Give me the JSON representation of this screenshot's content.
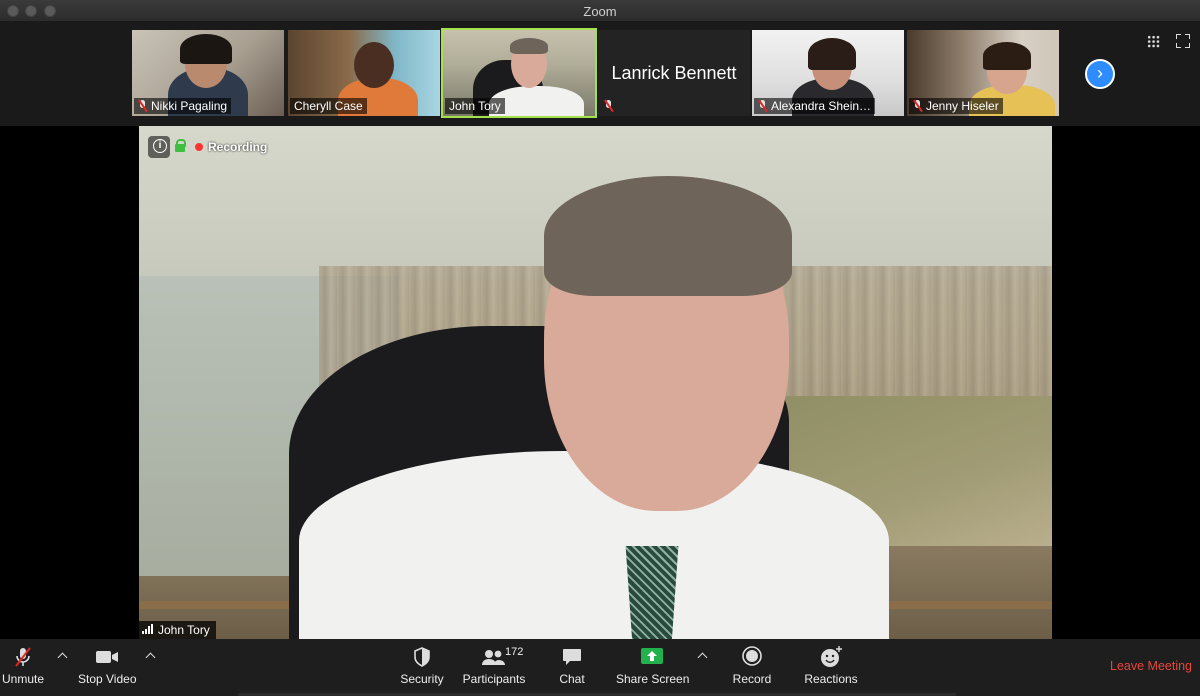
{
  "window": {
    "title": "Zoom"
  },
  "gallery": {
    "tiles": [
      {
        "name": "Nikki Pagaling",
        "muted": true
      },
      {
        "name": "Cheryll Case",
        "muted": false
      },
      {
        "name": "John Tory",
        "muted": false,
        "active_speaker": true
      },
      {
        "name": "Lanrick Bennett",
        "muted": true,
        "video_off": true
      },
      {
        "name": "Alexandra Shein…",
        "muted": true
      },
      {
        "name": "Jenny Hiseler",
        "muted": true
      }
    ],
    "next_icon": "chevron-right-icon",
    "view_icon": "grid-view-icon",
    "fullscreen_icon": "fullscreen-icon"
  },
  "main_video": {
    "recording_label": "Recording",
    "speaker_name": "John Tory",
    "accent": "#2d8cff",
    "active_outline": "#a5e14e"
  },
  "toolbar": {
    "unmute": "Unmute",
    "stop_video": "Stop Video",
    "security": "Security",
    "participants": "Participants",
    "participant_count": "172",
    "chat": "Chat",
    "share_screen": "Share Screen",
    "record": "Record",
    "reactions": "Reactions",
    "leave": "Leave Meeting",
    "leave_color": "#e8463c",
    "share_color": "#22b14c"
  }
}
